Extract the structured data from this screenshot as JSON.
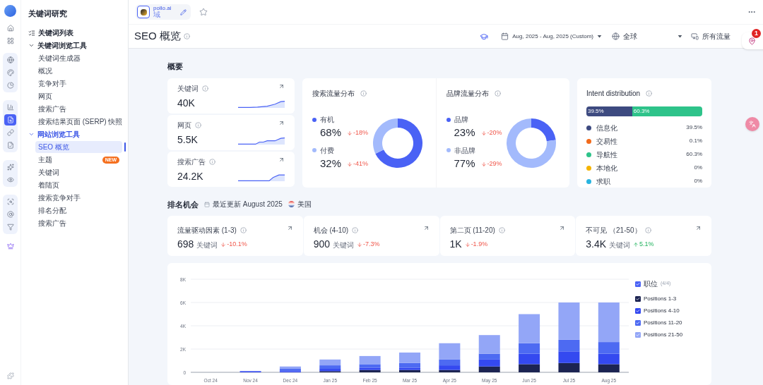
{
  "rail": [
    {
      "kind": "plain",
      "items": [
        {
          "kind": "home",
          "selected": false
        },
        {
          "kind": "apps",
          "selected": false
        }
      ]
    },
    {
      "kind": "group",
      "items": [
        {
          "kind": "globe",
          "selected": false
        },
        {
          "kind": "palette",
          "selected": false
        },
        {
          "kind": "pie",
          "selected": false
        }
      ]
    },
    {
      "kind": "group",
      "items": [
        {
          "kind": "chart",
          "selected": false
        },
        {
          "kind": "file-search",
          "selected": true
        },
        {
          "kind": "link",
          "selected": false
        },
        {
          "kind": "file-check",
          "selected": false
        }
      ]
    },
    {
      "kind": "group",
      "items": [
        {
          "kind": "sparkles",
          "selected": false
        },
        {
          "kind": "eye",
          "selected": false
        }
      ]
    },
    {
      "kind": "group",
      "items": [
        {
          "kind": "search-scan",
          "selected": false
        },
        {
          "kind": "at",
          "selected": false
        },
        {
          "kind": "funnel",
          "selected": false
        }
      ]
    },
    {
      "kind": "plain",
      "items": [
        {
          "kind": "crown",
          "selected": false
        }
      ]
    }
  ],
  "sidebar": {
    "title": "关键词研究",
    "items": [
      {
        "label": "关键词列表",
        "kind": "link",
        "selected": false
      },
      {
        "label": "关键词浏览工具",
        "kind": "group",
        "expanded": true,
        "selected": false,
        "children": [
          {
            "label": "关键词生成器",
            "selected": false
          },
          {
            "label": "概况",
            "selected": false
          },
          {
            "label": "竞争对手",
            "selected": false
          },
          {
            "label": "网页",
            "selected": false
          },
          {
            "label": "搜索广告",
            "selected": false
          },
          {
            "label": "搜索结果页面 (SERP) 快照",
            "selected": false
          }
        ]
      },
      {
        "label": "网站浏览工具",
        "kind": "group",
        "expanded": true,
        "selected": true,
        "children": [
          {
            "label": "SEO 概览",
            "selected": true
          },
          {
            "label": "主题",
            "selected": false,
            "badge": "NEW"
          },
          {
            "label": "关键词",
            "selected": false
          },
          {
            "label": "着陆页",
            "selected": false
          },
          {
            "label": "搜索竞争对手",
            "selected": false
          },
          {
            "label": "排名分配",
            "selected": false
          },
          {
            "label": "搜索广告",
            "selected": false
          }
        ]
      }
    ]
  },
  "project": {
    "name": "pollo.ai",
    "type": "域",
    "starred": false
  },
  "page_title": "SEO 概览",
  "toolbar": {
    "date_range": "Aug, 2025 - Aug, 2025 (Custom)",
    "region": "全球",
    "traffic": "所有流量"
  },
  "notification_badge": "1",
  "overview": {
    "title": "概要",
    "metrics": [
      {
        "label": "关键词",
        "value": "40K"
      },
      {
        "label": "网页",
        "value": "5.5K"
      },
      {
        "label": "搜索广告",
        "value": "24.2K"
      }
    ],
    "distributions": [
      {
        "items": [
          {
            "value": "68%",
            "change": "-18%",
            "rising": false,
            "color": "#4a62f5"
          },
          {
            "value": "32%",
            "change": "-41%",
            "rising": false,
            "color": "#a3bafc"
          }
        ],
        "chart_data": {
          "type": "donut",
          "title": "搜索流量分布",
          "categories": [
            "有机",
            "付费"
          ],
          "series": [
            {
              "values": [
                68,
                32
              ]
            }
          ]
        }
      },
      {
        "items": [
          {
            "value": "23%",
            "change": "-20%",
            "rising": false,
            "color": "#4a62f5"
          },
          {
            "value": "77%",
            "change": "-29%",
            "rising": false,
            "color": "#a3bafc"
          }
        ],
        "chart_data": {
          "type": "donut",
          "title": "品牌流量分布",
          "categories": [
            "品牌",
            "非品牌"
          ],
          "series": [
            {
              "values": [
                23,
                77
              ]
            }
          ]
        }
      }
    ],
    "intent": {
      "title": "Intent distribution",
      "bar": [
        {
          "label": "39.5%",
          "level": 0.395,
          "color": "#3d4a80"
        },
        {
          "label": "60.3%",
          "level": 0.603,
          "color": "#2ec38a"
        }
      ],
      "items": [
        {
          "label": "信息化",
          "value": "39.5%",
          "color": "#3d4a80"
        },
        {
          "label": "交易性",
          "value": "0.1%",
          "color": "#f26a1b"
        },
        {
          "label": "导航性",
          "value": "60.3%",
          "color": "#2ec38a"
        },
        {
          "label": "本地化",
          "value": "0%",
          "color": "#f5b400"
        },
        {
          "label": "求职",
          "value": "0%",
          "color": "#28b4e0"
        }
      ]
    }
  },
  "ranking": {
    "title": "排名机会",
    "updated": "最近更新 August 2025",
    "country": "美国",
    "cards": [
      {
        "label": "流量驱动因素 (1-3)",
        "value": "698",
        "unit": "关键词",
        "change": "-10.1%",
        "rising": false
      },
      {
        "label": "机会 (4-10)",
        "value": "900",
        "unit": "关键词",
        "change": "-7.3%",
        "rising": false
      },
      {
        "label": "第二页 (11-20)",
        "value": "1K",
        "change": "-1.9%",
        "rising": false
      },
      {
        "label": "不可见 （21-50）",
        "value": "3.4K",
        "unit": "关键词",
        "change": "5.1%",
        "rising": true
      }
    ],
    "legend": {
      "title": "职位",
      "count": "(4/4)",
      "checked": true,
      "items": [
        {
          "checked": true
        },
        {
          "checked": true
        },
        {
          "checked": true
        },
        {
          "checked": true
        }
      ]
    },
    "chart_data": {
      "type": "bar",
      "stacked": true,
      "grid": true,
      "categories": [
        "Oct 24",
        "Nov 24",
        "Dec 24",
        "Jan 25",
        "Feb 25",
        "Mar 25",
        "Apr 25",
        "May 25",
        "Jun 25",
        "Jul 25",
        "Aug 25"
      ],
      "ylim": [
        0,
        8000
      ],
      "yticks": [
        {
          "value": 0,
          "label": "0"
        },
        {
          "value": 2000,
          "label": "2K"
        },
        {
          "value": 4000,
          "label": "4K"
        },
        {
          "value": 6000,
          "label": "6K"
        },
        {
          "value": 8000,
          "label": "8K"
        }
      ],
      "series": [
        {
          "name": "Positions 1-3",
          "color": "#1c2452",
          "values": [
            0,
            0,
            0,
            100,
            200,
            200,
            200,
            500,
            700,
            800,
            700
          ]
        },
        {
          "name": "Positions 4-10",
          "color": "#3449f0",
          "values": [
            0,
            100,
            100,
            200,
            200,
            200,
            400,
            600,
            900,
            1000,
            900
          ]
        },
        {
          "name": "Positions 11-20",
          "color": "#4d6af2",
          "values": [
            0,
            0,
            200,
            300,
            300,
            400,
            500,
            500,
            900,
            1000,
            1000
          ]
        },
        {
          "name": "Positions 21-50",
          "color": "#93a6f7",
          "values": [
            0,
            0,
            200,
            500,
            700,
            900,
            1400,
            1600,
            2500,
            3200,
            3400
          ]
        }
      ]
    }
  }
}
